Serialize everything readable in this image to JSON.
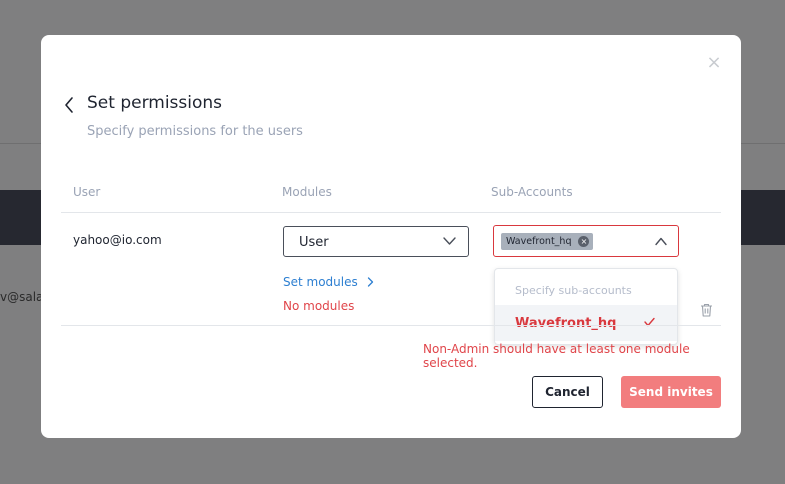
{
  "background": {
    "partial_text": "v@sala"
  },
  "modal": {
    "close_glyph": "×",
    "title": "Set permissions",
    "subtitle": "Specify permissions for the users",
    "columns": {
      "user": "User",
      "modules": "Modules",
      "sub_accounts": "Sub-Accounts"
    },
    "row": {
      "email": "yahoo@io.com",
      "module_value": "User",
      "set_modules_label": "Set modules",
      "no_modules_label": "No modules",
      "selected_chip": "Wavefront_hq",
      "chip_remove_glyph": "×"
    },
    "dropdown": {
      "placeholder": "Specify sub-accounts",
      "options": [
        {
          "label": "Wavefront_hq",
          "selected": true
        }
      ]
    },
    "error_message": "Non-Admin should have at least one module selected.",
    "buttons": {
      "cancel": "Cancel",
      "send": "Send invites"
    }
  },
  "colors": {
    "overlay": "#7f7f80",
    "error": "#e0454a",
    "link": "#2d7fd1",
    "primary_disabled": "#f27d7e"
  },
  "icons": [
    "back-chevron-icon",
    "close-icon",
    "chevron-down-icon",
    "chevron-up-icon",
    "chip-remove-icon",
    "checkmark-icon",
    "trash-icon",
    "chevron-right-icon"
  ]
}
